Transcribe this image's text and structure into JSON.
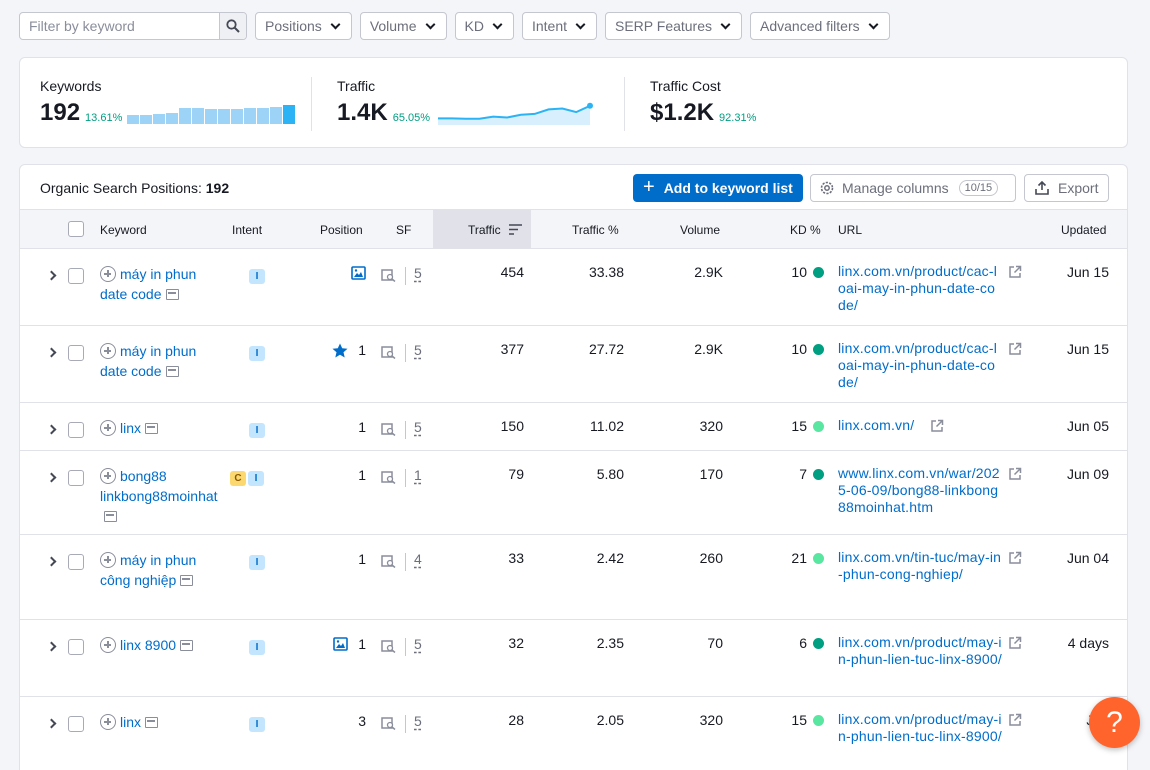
{
  "filters": {
    "search_placeholder": "Filter by keyword",
    "buttons": [
      "Positions",
      "Volume",
      "KD",
      "Intent",
      "SERP Features",
      "Advanced filters"
    ]
  },
  "summary": {
    "keywords": {
      "label": "Keywords",
      "value": "192",
      "change": "13.61%"
    },
    "traffic": {
      "label": "Traffic",
      "value": "1.4K",
      "change": "65.05%"
    },
    "traffic_cost": {
      "label": "Traffic Cost",
      "value": "$1.2K",
      "change": "92.31%"
    },
    "keywords_bars": [
      0.45,
      0.45,
      0.5,
      0.55,
      0.8,
      0.8,
      0.75,
      0.75,
      0.75,
      0.8,
      0.8,
      0.85,
      0.95
    ],
    "traffic_trend": [
      0.2,
      0.2,
      0.18,
      0.18,
      0.3,
      0.25,
      0.4,
      0.45,
      0.7,
      0.75,
      0.55,
      0.9
    ]
  },
  "panel": {
    "title": "Organic Search Positions:",
    "count": "192",
    "add_button": "Add to keyword list",
    "manage_button": "Manage columns",
    "manage_count": "10/15",
    "export_button": "Export"
  },
  "columns": [
    "Keyword",
    "Intent",
    "Position",
    "SF",
    "Traffic",
    "Traffic %",
    "Volume",
    "KD %",
    "URL",
    "Updated"
  ],
  "rows": [
    {
      "keyword": "máy in phun date code",
      "intent": [
        "I"
      ],
      "position_icon": "image-icon",
      "position": "",
      "sf": "5",
      "traffic": "454",
      "traffic_pct": "33.38",
      "volume": "2.9K",
      "kd": "10",
      "kd_color": "#009f81",
      "url": "linx.com.vn/product/cac-loai-may-in-phun-date-code/",
      "updated": "Jun 15"
    },
    {
      "keyword": "máy in phun date code",
      "intent": [
        "I"
      ],
      "position_icon": "star-icon",
      "position": "1",
      "sf": "5",
      "traffic": "377",
      "traffic_pct": "27.72",
      "volume": "2.9K",
      "kd": "10",
      "kd_color": "#009f81",
      "url": "linx.com.vn/product/cac-loai-may-in-phun-date-code/",
      "updated": "Jun 15"
    },
    {
      "keyword": "linx",
      "intent": [
        "I"
      ],
      "position_icon": "",
      "position": "1",
      "sf": "5",
      "traffic": "150",
      "traffic_pct": "11.02",
      "volume": "320",
      "kd": "15",
      "kd_color": "#59e6a0",
      "url": "linx.com.vn/",
      "updated": "Jun 05"
    },
    {
      "keyword": "bong88 linkbong88moinhat",
      "intent": [
        "C",
        "I"
      ],
      "position_icon": "",
      "position": "1",
      "sf": "1",
      "traffic": "79",
      "traffic_pct": "5.80",
      "volume": "170",
      "kd": "7",
      "kd_color": "#009f81",
      "url": "www.linx.com.vn/war/2025-06-09/bong88-linkbong88moinhat.htm",
      "updated": "Jun 09"
    },
    {
      "keyword": "máy in phun công nghiệp",
      "intent": [
        "I"
      ],
      "position_icon": "",
      "position": "1",
      "sf": "4",
      "traffic": "33",
      "traffic_pct": "2.42",
      "volume": "260",
      "kd": "21",
      "kd_color": "#59e6a0",
      "url": "linx.com.vn/tin-tuc/may-in-phun-cong-nghiep/",
      "updated": "Jun 04"
    },
    {
      "keyword": "linx 8900",
      "intent": [
        "I"
      ],
      "position_icon": "image-icon",
      "position": "1",
      "sf": "5",
      "traffic": "32",
      "traffic_pct": "2.35",
      "volume": "70",
      "kd": "6",
      "kd_color": "#009f81",
      "url": "linx.com.vn/product/may-in-phun-lien-tuc-linx-8900/",
      "updated": "4 days"
    },
    {
      "keyword": "linx",
      "intent": [
        "I"
      ],
      "position_icon": "",
      "position": "3",
      "sf": "5",
      "traffic": "28",
      "traffic_pct": "2.05",
      "volume": "320",
      "kd": "15",
      "kd_color": "#59e6a0",
      "url": "linx.com.vn/product/may-in-phun-lien-tuc-linx-8900/",
      "updated": "Jun"
    }
  ],
  "colors": {
    "accent": "#006dca",
    "positive": "#009f81",
    "help": "#ff642d"
  }
}
